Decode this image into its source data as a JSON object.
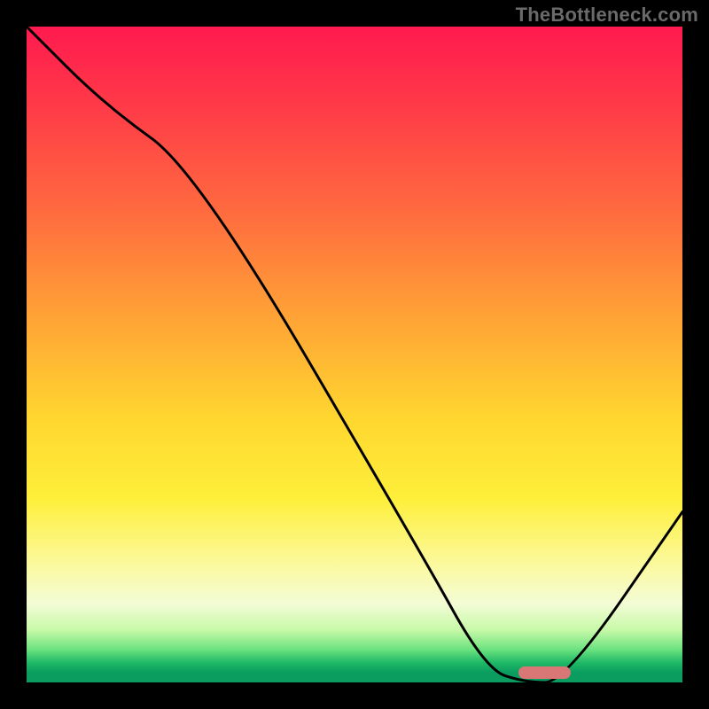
{
  "watermark": "TheBottleneck.com",
  "chart_data": {
    "type": "line",
    "title": "",
    "xlabel": "",
    "ylabel": "",
    "xlim": [
      0,
      100
    ],
    "ylim": [
      0,
      100
    ],
    "grid": false,
    "legend": false,
    "series": [
      {
        "name": "bottleneck-curve",
        "x": [
          0,
          12,
          26,
          60,
          70,
          76,
          82,
          100
        ],
        "values": [
          100,
          88,
          78,
          20,
          2,
          0,
          0,
          26
        ]
      }
    ],
    "marker": {
      "x_start": 75,
      "x_end": 83,
      "y": 1.5
    },
    "background_gradient_stops": [
      {
        "pct": 0,
        "color": "#ff1a4f"
      },
      {
        "pct": 28,
        "color": "#ff6a3f"
      },
      {
        "pct": 60,
        "color": "#ffd72f"
      },
      {
        "pct": 82,
        "color": "#fbf99e"
      },
      {
        "pct": 95,
        "color": "#6be27f"
      },
      {
        "pct": 100,
        "color": "#0a9d5f"
      }
    ]
  }
}
